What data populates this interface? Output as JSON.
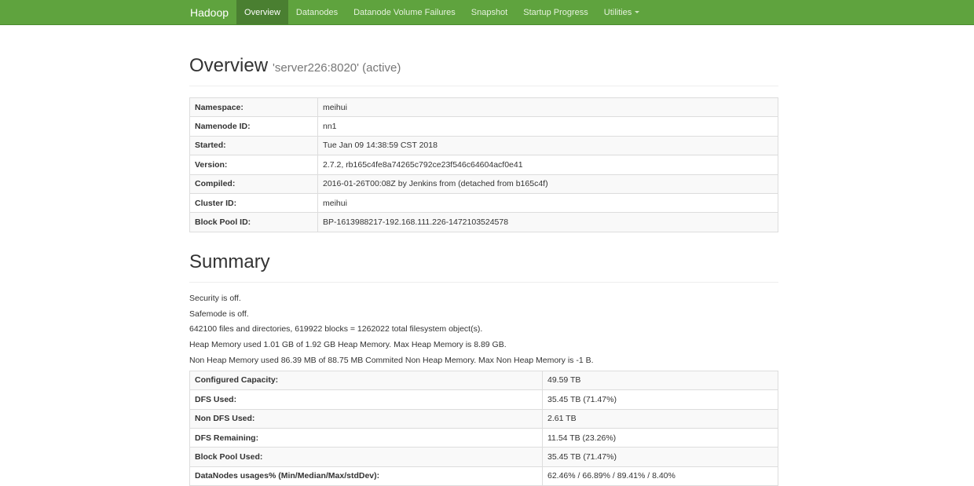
{
  "navbar": {
    "brand": "Hadoop",
    "items": [
      {
        "label": "Overview",
        "active": true
      },
      {
        "label": "Datanodes"
      },
      {
        "label": "Datanode Volume Failures"
      },
      {
        "label": "Snapshot"
      },
      {
        "label": "Startup Progress"
      },
      {
        "label": "Utilities"
      }
    ],
    "accent": "#5fa33e"
  },
  "overview": {
    "title": "Overview",
    "subtitle": "'server226:8020' (active)",
    "rows": [
      {
        "key": "Namespace:",
        "value": "meihui"
      },
      {
        "key": "Namenode ID:",
        "value": "nn1"
      },
      {
        "key": "Started:",
        "value": "Tue Jan 09 14:38:59 CST 2018"
      },
      {
        "key": "Version:",
        "value": "2.7.2, rb165c4fe8a74265c792ce23f546c64604acf0e41"
      },
      {
        "key": "Compiled:",
        "value": "2016-01-26T00:08Z by Jenkins from (detached from b165c4f)"
      },
      {
        "key": "Cluster ID:",
        "value": "meihui"
      },
      {
        "key": "Block Pool ID:",
        "value": "BP-1613988217-192.168.111.226-1472103524578"
      }
    ]
  },
  "summary": {
    "title": "Summary",
    "lines": [
      "Security is off.",
      "Safemode is off.",
      "642100 files and directories, 619922 blocks = 1262022 total filesystem object(s).",
      "Heap Memory used 1.01 GB of 1.92 GB Heap Memory. Max Heap Memory is 8.89 GB.",
      "Non Heap Memory used 86.39 MB of 88.75 MB Commited Non Heap Memory. Max Non Heap Memory is -1 B."
    ],
    "rows": [
      {
        "key": "Configured Capacity:",
        "value": "49.59 TB"
      },
      {
        "key": "DFS Used:",
        "value": "35.45 TB (71.47%)"
      },
      {
        "key": "Non DFS Used:",
        "value": "2.61 TB"
      },
      {
        "key": "DFS Remaining:",
        "value": "11.54 TB (23.26%)"
      },
      {
        "key": "Block Pool Used:",
        "value": "35.45 TB (71.47%)"
      },
      {
        "key": "DataNodes usages% (Min/Median/Max/stdDev):",
        "value": "62.46% / 66.89% / 89.41% / 8.40%"
      }
    ]
  }
}
